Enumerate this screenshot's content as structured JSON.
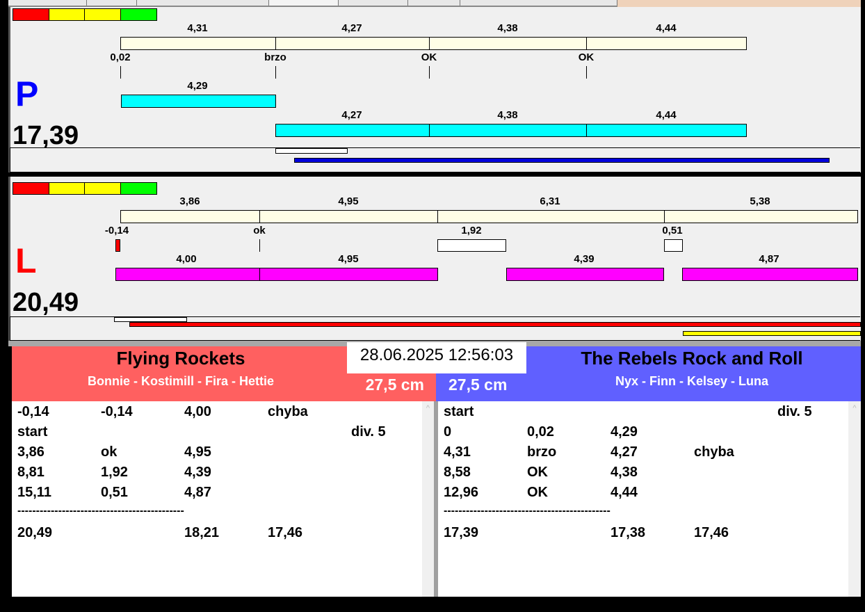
{
  "colors": {
    "red": "#ff0000",
    "yellow": "#ffff00",
    "green": "#00ff00",
    "cream": "#fffee6",
    "cyan": "#00ffff",
    "magenta": "#ff00ff",
    "blue_line": "#0000dd",
    "team_left": "#ff6060",
    "team_right": "#6060ff"
  },
  "lane_p": {
    "letter": "P",
    "total": "17,39",
    "top_bar_labels": [
      "4,31",
      "4,27",
      "4,38",
      "4,44"
    ],
    "reaction_labels": [
      "0,02",
      "brzo",
      "OK",
      "OK"
    ],
    "run_bar1_label": "4,29",
    "run_bar2_labels": [
      "4,27",
      "4,38",
      "4,44"
    ]
  },
  "lane_l": {
    "letter": "L",
    "total": "20,49",
    "top_bar_labels": [
      "3,86",
      "4,95",
      "6,31",
      "5,38"
    ],
    "reaction_labels": [
      "-0,14",
      "ok",
      "1,92",
      "0,51"
    ],
    "run_bar_labels": [
      "4,00",
      "4,95",
      "4,39",
      "4,87"
    ]
  },
  "datetime": "28.06.2025 12:56:03",
  "team_left": {
    "name": "Flying Rockets",
    "members": "Bonnie - Kostimill - Fira - Hettie",
    "height": "27,5 cm"
  },
  "team_right": {
    "name": "The Rebels Rock and Roll",
    "members": "Nyx - Finn - Kelsey - Luna",
    "height": "27,5 cm"
  },
  "list_left": [
    [
      "-0,14",
      "-0,14",
      "4,00",
      "chyba",
      ""
    ],
    [
      "start",
      "",
      "",
      "",
      "div.  5"
    ],
    [
      "3,86",
      "ok",
      "4,95",
      "",
      ""
    ],
    [
      "8,81",
      "1,92",
      "4,39",
      "",
      ""
    ],
    [
      "15,11",
      "0,51",
      "4,87",
      "",
      ""
    ],
    [
      "---------------------------------------------",
      "",
      "",
      "",
      ""
    ],
    [
      "20,49",
      "",
      "18,21",
      "17,46",
      ""
    ]
  ],
  "list_right": [
    [
      "start",
      "",
      "",
      "",
      "div.  5"
    ],
    [
      "0",
      "0,02",
      "4,29",
      "",
      ""
    ],
    [
      "4,31",
      "brzo",
      "4,27",
      "chyba",
      ""
    ],
    [
      "8,58",
      "OK",
      "4,38",
      "",
      ""
    ],
    [
      "12,96",
      "OK",
      "4,44",
      "",
      ""
    ],
    [
      "---------------------------------------------",
      "",
      "",
      "",
      ""
    ],
    [
      "17,39",
      "",
      "17,38",
      "17,46",
      ""
    ]
  ]
}
